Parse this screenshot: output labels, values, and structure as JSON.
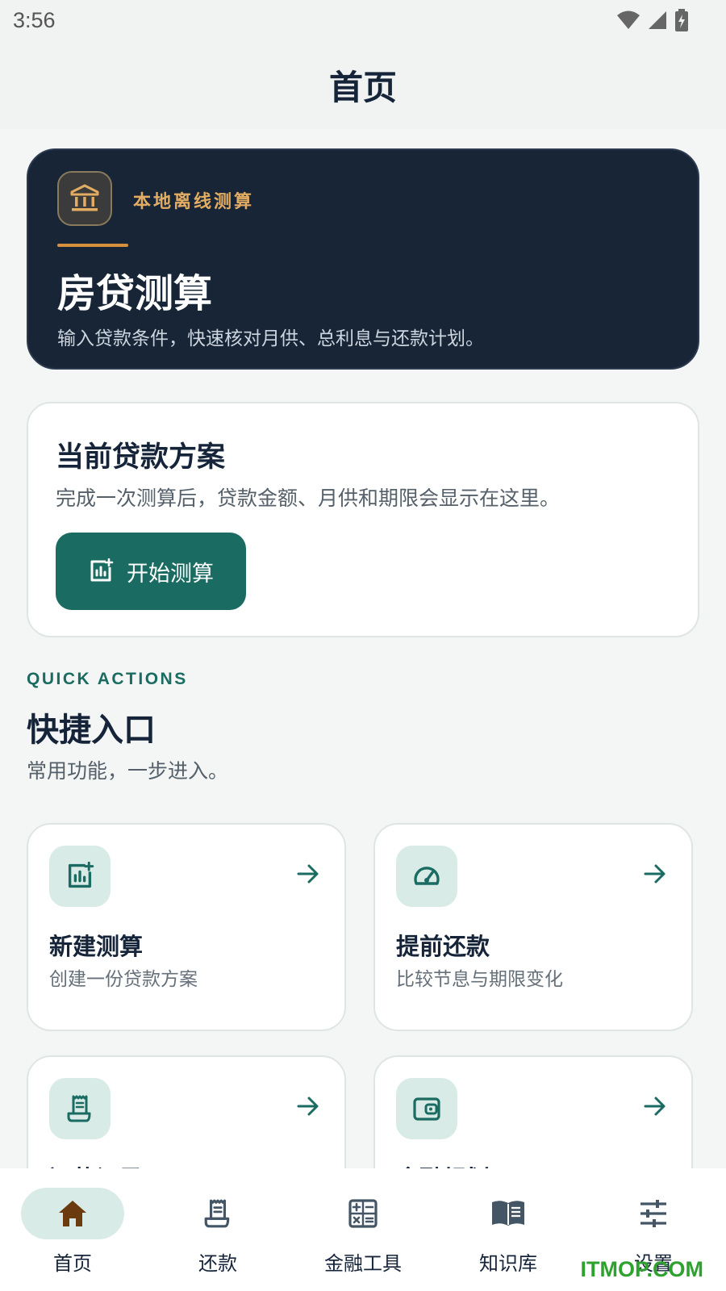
{
  "status": {
    "time": "3:56"
  },
  "app_bar": {
    "title": "首页"
  },
  "hero": {
    "tag": "本地离线测算",
    "title": "房贷测算",
    "subtitle": "输入贷款条件，快速核对月供、总利息与还款计划。",
    "icon": "bank-icon"
  },
  "plan": {
    "title": "当前贷款方案",
    "description": "完成一次测算后，贷款金额、月供和期限会显示在这里。",
    "button_label": "开始测算"
  },
  "quick": {
    "eyebrow": "QUICK ACTIONS",
    "title": "快捷入口",
    "subtitle": "常用功能，一步进入。",
    "items": [
      {
        "title": "新建测算",
        "subtitle": "创建一份贷款方案",
        "icon": "chart-add-icon"
      },
      {
        "title": "提前还款",
        "subtitle": "比较节息与期限变化",
        "icon": "speedometer-icon"
      },
      {
        "title": "还款记录",
        "subtitle": "",
        "icon": "receipt-icon"
      },
      {
        "title": "金融规划",
        "subtitle": "",
        "icon": "wallet-icon"
      }
    ]
  },
  "nav": {
    "items": [
      {
        "label": "首页",
        "icon": "home-icon",
        "active": true
      },
      {
        "label": "还款",
        "icon": "receipt-icon",
        "active": false
      },
      {
        "label": "金融工具",
        "icon": "calculator-icon",
        "active": false
      },
      {
        "label": "知识库",
        "icon": "book-icon",
        "active": false
      },
      {
        "label": "设置",
        "icon": "sliders-icon",
        "active": false
      }
    ]
  },
  "watermark": "ITMOP.COM",
  "colors": {
    "primary": "#1a6b61",
    "hero_bg": "#172537",
    "accent_gold": "#e2ad63",
    "tint": "#d9ebe6"
  }
}
